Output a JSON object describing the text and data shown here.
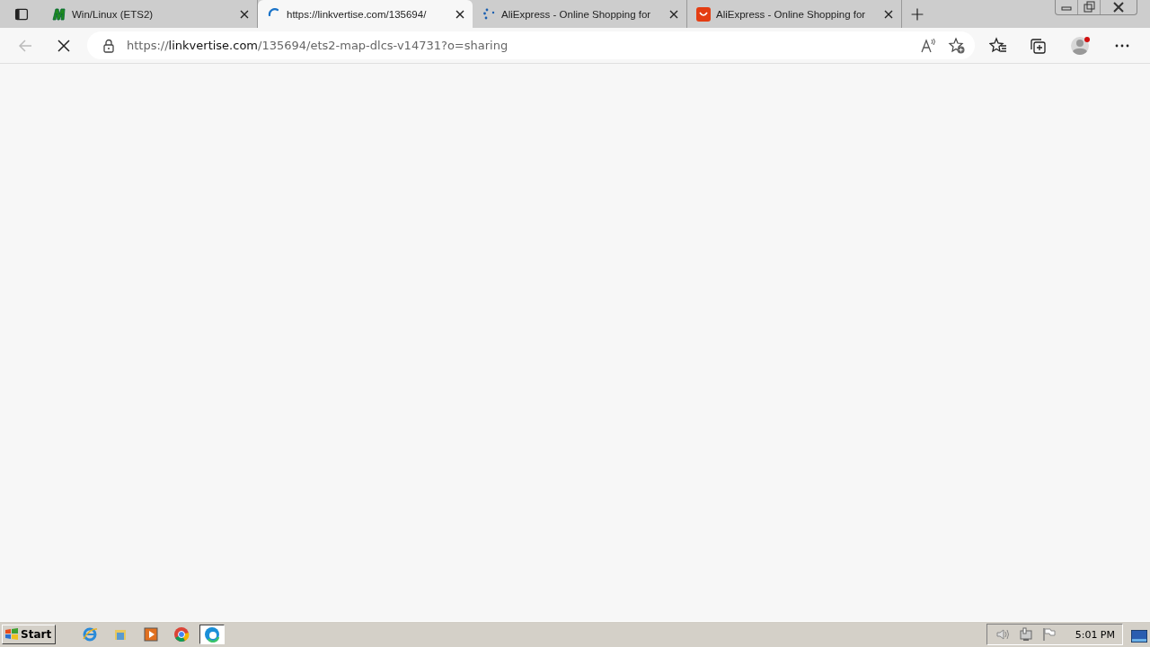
{
  "tabs": [
    {
      "title": "Win/Linux (ETS2)",
      "kind": "m-logo",
      "selected": false
    },
    {
      "title": "https://linkvertise.com/135694/",
      "kind": "spinner",
      "selected": true
    },
    {
      "title": "AliExpress - Online Shopping for",
      "kind": "dots",
      "selected": false
    },
    {
      "title": "AliExpress - Online Shopping for",
      "kind": "bag",
      "selected": false
    }
  ],
  "address_bar": {
    "scheme": "https://",
    "host": "linkvertise.com",
    "path": "/135694/ets2-map-dlcs-v14731?o=sharing"
  },
  "taskbar": {
    "start_label": "Start",
    "apps": [
      {
        "kind": "ie",
        "selected": false
      },
      {
        "kind": "folder",
        "selected": false
      },
      {
        "kind": "media",
        "selected": false
      },
      {
        "kind": "chrome",
        "selected": false
      },
      {
        "kind": "edge",
        "selected": true
      }
    ],
    "clock": "5:01 PM"
  }
}
